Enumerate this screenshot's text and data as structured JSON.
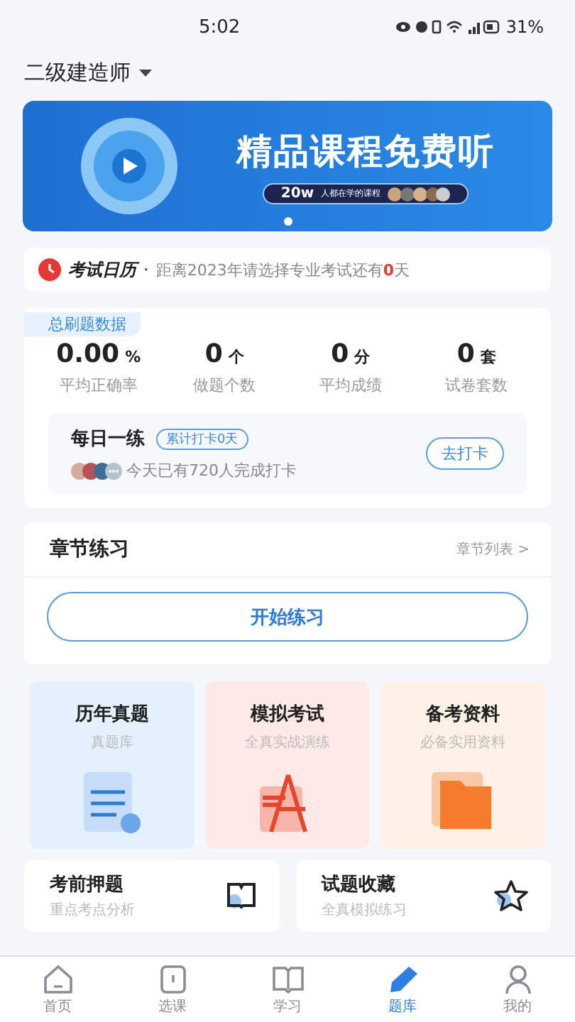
{
  "status_bar": {
    "time": "5:02",
    "battery": "31%"
  },
  "header": {
    "title": "二级建造师"
  },
  "banner": {
    "title": "精品课程免费听",
    "count": "20w",
    "caption": "人都在学的课程",
    "pages": [
      {
        "selected": true
      }
    ]
  },
  "exam_calendar": {
    "label": "考试日历",
    "separator": "·",
    "text": "距离2023年请选择专业考试还有**0**天"
  },
  "stats": {
    "tag": "总刷题数据",
    "items": [
      {
        "value": "0.00",
        "unit": "%",
        "label": "平均正确率"
      },
      {
        "value": "0",
        "unit": "个",
        "label": "做题个数"
      },
      {
        "value": "0",
        "unit": "分",
        "label": "平均成绩"
      },
      {
        "value": "0",
        "unit": "套",
        "label": "试卷套数"
      }
    ]
  },
  "daily": {
    "title": "每日一练",
    "badge": "累计打卡0天",
    "text": "今天已有720人完成打卡",
    "button": "去打卡",
    "avatars": [
      {
        "color": "#d4ab9c"
      },
      {
        "color": "#b9535a"
      },
      {
        "color": "#3f6f96"
      }
    ]
  },
  "chapter": {
    "title": "章节练习",
    "link": "章节列表",
    "link_icon": ">",
    "button": "开始练习"
  },
  "tiles": [
    {
      "kind": "papers",
      "title": "历年真题",
      "subtitle": "真题库"
    },
    {
      "kind": "mock",
      "title": "模拟考试",
      "subtitle": "全真实战演练"
    },
    {
      "kind": "materials",
      "title": "备考资料",
      "subtitle": "必备实用资料"
    }
  ],
  "cards": [
    {
      "kind": "book",
      "title": "考前押题",
      "subtitle": "重点考点分析"
    },
    {
      "kind": "star",
      "title": "试题收藏",
      "subtitle": "全真模拟练习"
    }
  ],
  "tabbar": [
    {
      "kind": "home",
      "label": "首页",
      "selected": false
    },
    {
      "kind": "course",
      "label": "选课",
      "selected": false
    },
    {
      "kind": "study",
      "label": "学习",
      "selected": false
    },
    {
      "kind": "bank",
      "label": "题库",
      "selected": true
    },
    {
      "kind": "me",
      "label": "我的",
      "selected": false
    }
  ]
}
